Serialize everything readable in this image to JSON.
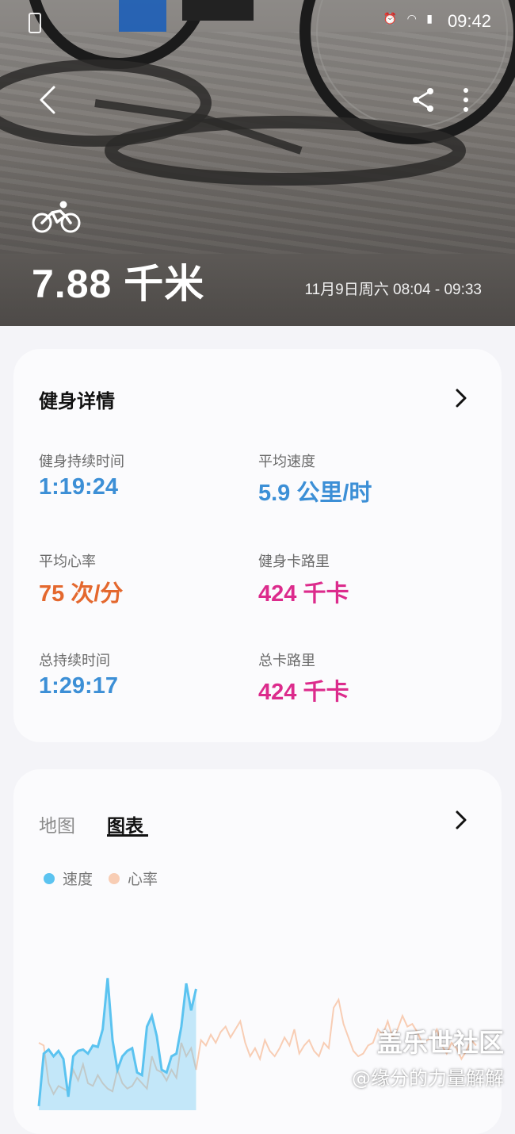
{
  "status_bar": {
    "time": "09:42",
    "icons": [
      "battery-icon",
      "alarm-icon",
      "wifi-icon",
      "signal-icon"
    ]
  },
  "hero": {
    "distance": "7.88 千米",
    "date_range": "11月9日周六 08:04 - 09:33",
    "activity_icon": "cycling-icon"
  },
  "workout_details": {
    "title": "健身详情",
    "stats": [
      {
        "label": "健身持续时间",
        "value": "1:19:24",
        "color": "#3c8fd6"
      },
      {
        "label": "平均速度",
        "value": "5.9 公里/时",
        "color": "#3c8fd6"
      },
      {
        "label": "平均心率",
        "value": "75 次/分",
        "color": "#e4682e"
      },
      {
        "label": "健身卡路里",
        "value": "424 千卡",
        "color": "#dc2b8c"
      },
      {
        "label": "总持续时间",
        "value": "1:29:17",
        "color": "#3c8fd6"
      },
      {
        "label": "总卡路里",
        "value": "424 千卡",
        "color": "#dc2b8c"
      }
    ]
  },
  "chart_card": {
    "tabs": [
      {
        "label": "地图",
        "selected": false
      },
      {
        "label": "图表",
        "selected": true
      }
    ],
    "legend": [
      {
        "name": "速度",
        "color": "#5bc3f0"
      },
      {
        "name": "心率",
        "color": "#f8cdb4"
      }
    ]
  },
  "chart_data": {
    "type": "area",
    "series": [
      {
        "name": "速度",
        "color": "#5bc3f0",
        "values": [
          3,
          42,
          45,
          40,
          44,
          38,
          10,
          40,
          44,
          45,
          42,
          48,
          47,
          60,
          98,
          52,
          30,
          40,
          44,
          46,
          28,
          26,
          62,
          70,
          55,
          30,
          28,
          40,
          42,
          62,
          94,
          74,
          90,
          0,
          0,
          0,
          0,
          0,
          0,
          0,
          0,
          0,
          0,
          0,
          0,
          0,
          0,
          0,
          0,
          0,
          0,
          0,
          0,
          0,
          0,
          0,
          0,
          0,
          0,
          0,
          0,
          0,
          0,
          0,
          0,
          0,
          0,
          0,
          0,
          0,
          0,
          0,
          0,
          0,
          0,
          0,
          0,
          0,
          0,
          0,
          0,
          0,
          0,
          0,
          0,
          0,
          0,
          0,
          0,
          0
        ]
      },
      {
        "name": "心率",
        "color": "#f8cdb4",
        "values": [
          50,
          48,
          20,
          12,
          18,
          16,
          14,
          30,
          22,
          34,
          20,
          18,
          26,
          20,
          16,
          14,
          30,
          20,
          16,
          18,
          24,
          20,
          16,
          40,
          30,
          28,
          22,
          30,
          24,
          50,
          40,
          46,
          30,
          52,
          48,
          56,
          50,
          58,
          62,
          54,
          60,
          66,
          50,
          40,
          46,
          38,
          52,
          44,
          40,
          46,
          54,
          48,
          60,
          42,
          48,
          52,
          44,
          40,
          50,
          46,
          76,
          82,
          64,
          54,
          44,
          40,
          42,
          48,
          50,
          60,
          56,
          66,
          54,
          60,
          70,
          62,
          64,
          58,
          50,
          52,
          54,
          60,
          48,
          42,
          50,
          46,
          38,
          44,
          52,
          48
        ]
      }
    ]
  },
  "watermark": {
    "line1": "盖乐世社区",
    "line2": "@缘分的力量解解"
  }
}
